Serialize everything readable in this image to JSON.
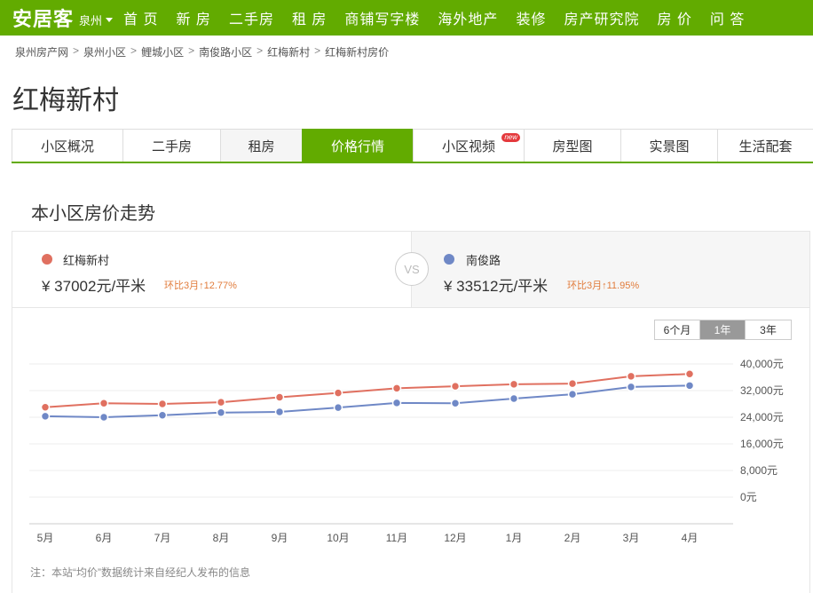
{
  "nav": {
    "logo": "安居客",
    "city": "泉州",
    "items": [
      "首 页",
      "新 房",
      "二手房",
      "租 房",
      "商铺写字楼",
      "海外地产",
      "装修",
      "房产研究院",
      "房 价",
      "问 答"
    ]
  },
  "breadcrumb": [
    "泉州房产网",
    "泉州小区",
    "鲤城小区",
    "南俊路小区",
    "红梅新村",
    "红梅新村房价"
  ],
  "page_title": "红梅新村",
  "tabs": [
    {
      "label": "小区概况"
    },
    {
      "label": "二手房"
    },
    {
      "label": "租房"
    },
    {
      "label": "价格行情"
    },
    {
      "label": "小区视频",
      "badge": "new"
    },
    {
      "label": "房型图"
    },
    {
      "label": "实景图"
    },
    {
      "label": "生活配套"
    }
  ],
  "section_title": "本小区房价走势",
  "compare": {
    "left": {
      "name": "红梅新村",
      "price": "¥ 37002元/平米",
      "trend": "环比3月↑12.77%",
      "color": "#e07060"
    },
    "vs": "VS",
    "right": {
      "name": "南俊路",
      "price": "¥ 33512元/平米",
      "trend": "环比3月↑11.95%",
      "color": "#6f88c6"
    }
  },
  "range": {
    "options": [
      "6个月",
      "1年",
      "3年"
    ],
    "selected": "1年"
  },
  "chart_data": {
    "type": "line",
    "categories": [
      "5月",
      "6月",
      "7月",
      "8月",
      "9月",
      "10月",
      "11月",
      "12月",
      "1月",
      "2月",
      "3月",
      "4月"
    ],
    "series": [
      {
        "name": "红梅新村",
        "color": "#e07060",
        "values": [
          27000,
          28200,
          28000,
          28500,
          30000,
          31300,
          32700,
          33300,
          33900,
          34100,
          36300,
          37002
        ]
      },
      {
        "name": "南俊路",
        "color": "#6f88c6",
        "values": [
          24300,
          24000,
          24600,
          25400,
          25600,
          26900,
          28300,
          28200,
          29600,
          30900,
          33100,
          33512
        ]
      }
    ],
    "yticks": [
      "40,000元",
      "32,000元",
      "24,000元",
      "16,000元",
      "8,000元",
      "0元"
    ],
    "ylim": [
      0,
      40000
    ],
    "grid": true
  },
  "note": "注：本站“均价”数据统计来自经纪人发布的信息"
}
